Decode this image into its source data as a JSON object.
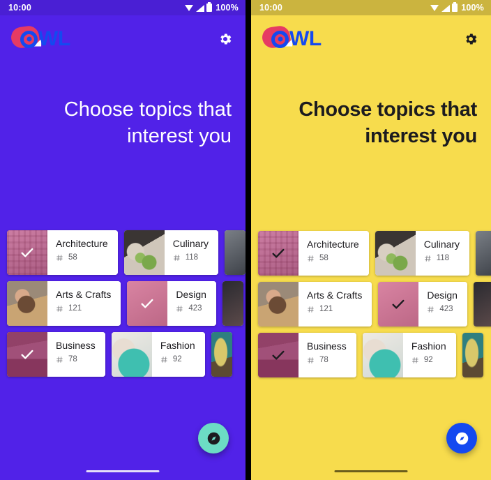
{
  "status_bar": {
    "time": "10:00",
    "battery_percent": "100%",
    "icons": [
      "wifi-icon",
      "signal-icon",
      "battery-icon"
    ]
  },
  "app": {
    "logo_text": "OWL",
    "settings_icon": "gear-icon"
  },
  "screens": [
    {
      "theme": "purple",
      "background": "#5122E8",
      "statusbar_bg": "#4A1FD4",
      "title": "Choose topics that interest you",
      "title_color": "#FFFFFF",
      "title_weight": "normal",
      "check_color": "#FFFFFF",
      "fab": {
        "color": "#6CDCC4",
        "icon": "explore-compass-icon",
        "icon_color": "#1C1B1F"
      },
      "home_indicator_color": "#E5DEF8"
    },
    {
      "theme": "yellow",
      "background": "#F7DC4D",
      "statusbar_bg": "#CBB43F",
      "title": "Choose topics that interest you",
      "title_color": "#1C1B1F",
      "title_weight": "bold",
      "check_color": "#1C1B1F",
      "fab": {
        "color": "#1449F0",
        "icon": "explore-compass-icon",
        "icon_color": "#FFFFFF"
      },
      "home_indicator_color": "#6B5E1C"
    }
  ],
  "topics": {
    "selected_overlay_color": "#E5327A",
    "hash_icon": "hash-grid-icon",
    "rows": [
      [
        {
          "name": "Architecture",
          "count": "58",
          "selected": true,
          "photo": "ph-arch"
        },
        {
          "name": "Culinary",
          "count": "118",
          "selected": false,
          "photo": "ph-culinary"
        },
        {
          "name": "",
          "count": "",
          "selected": false,
          "photo": "ph-edge3",
          "partial": true
        }
      ],
      [
        {
          "name": "Arts & Crafts",
          "count": "121",
          "selected": false,
          "photo": "ph-crafts"
        },
        {
          "name": "Design",
          "count": "423",
          "selected": true,
          "photo": "ph-design"
        },
        {
          "name": "",
          "count": "",
          "selected": false,
          "photo": "ph-edge2",
          "partial": true
        }
      ],
      [
        {
          "name": "Business",
          "count": "78",
          "selected": true,
          "photo": "ph-business"
        },
        {
          "name": "Fashion",
          "count": "92",
          "selected": false,
          "photo": "ph-fashion"
        },
        {
          "name": "",
          "count": "",
          "selected": false,
          "photo": "ph-edge",
          "partial": true
        }
      ]
    ]
  }
}
